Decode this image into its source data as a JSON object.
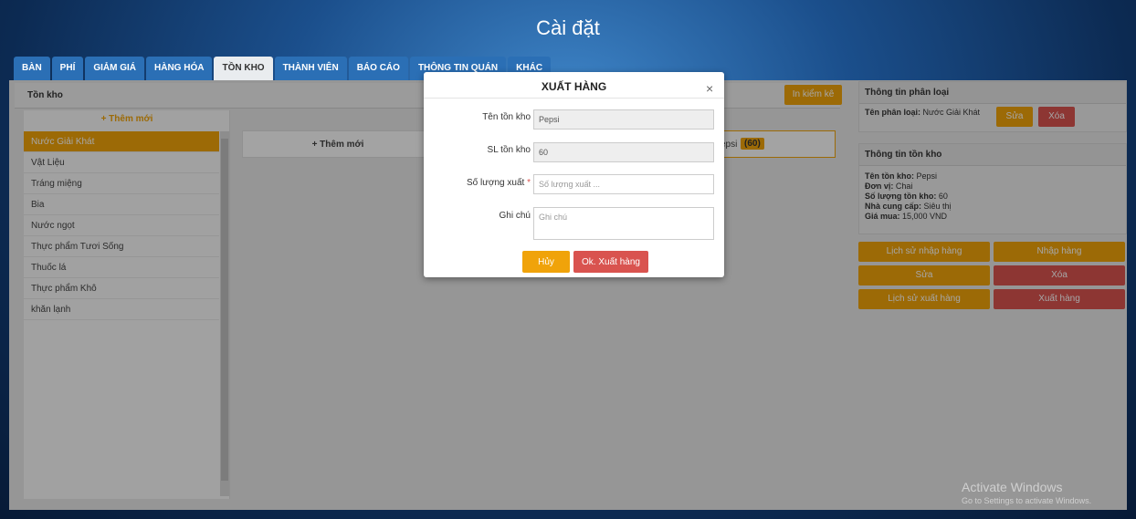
{
  "window": {
    "title": "Cài đặt"
  },
  "tabs": [
    {
      "label": "BÀN"
    },
    {
      "label": "PHÍ"
    },
    {
      "label": "GIẢM GIÁ"
    },
    {
      "label": "HÀNG HÓA"
    },
    {
      "label": "TỒN KHO",
      "active": true
    },
    {
      "label": "THÀNH VIÊN"
    },
    {
      "label": "BÁO CÁO"
    },
    {
      "label": "THÔNG TIN QUÁN"
    },
    {
      "label": "KHÁC"
    }
  ],
  "inventory": {
    "header": "Tồn kho",
    "print_button": "In kiểm kê",
    "add_category": "+ Thêm mới",
    "add_item": "+ Thêm mới",
    "categories": [
      "Nước Giải Khát",
      "Vật Liệu",
      "Tráng miệng",
      "Bia",
      "Nước ngọt",
      "Thực phẩm Tươi Sống",
      "Thuốc lá",
      "Thực phẩm Khô",
      "khăn lạnh"
    ],
    "items": [
      {
        "name": "epsi",
        "qty": "(60)"
      }
    ]
  },
  "category_info": {
    "title": "Thông tin phân loại",
    "label": "Tên phân loại:",
    "value": "Nước Giải Khát",
    "edit": "Sửa",
    "delete": "Xóa"
  },
  "stock_info": {
    "title": "Thông tin tồn kho",
    "lines": [
      {
        "label": "Tên tồn kho:",
        "value": "Pepsi"
      },
      {
        "label": "Đơn vị:",
        "value": "Chai"
      },
      {
        "label": "Số lượng tồn kho:",
        "value": "60"
      },
      {
        "label": "Nhà cung cấp:",
        "value": "Siêu thị"
      },
      {
        "label": "Giá mua:",
        "value": "15,000 VND"
      }
    ],
    "buttons": {
      "import_history": "Lịch sử nhập hàng",
      "import": "Nhập hàng",
      "edit": "Sửa",
      "delete": "Xóa",
      "export_history": "Lịch sử xuất hàng",
      "export": "Xuất hàng"
    }
  },
  "modal": {
    "title": "XUẤT HÀNG",
    "close": "×",
    "fields": {
      "name_label": "Tên tồn kho",
      "name_value": "Pepsi",
      "stock_label": "SL tồn kho",
      "stock_value": "60",
      "qty_label": "Số lượng xuất",
      "qty_required": "*",
      "qty_placeholder": "Số lượng xuất ...",
      "note_label": "Ghi chú",
      "note_placeholder": "Ghi chú"
    },
    "cancel": "Hủy",
    "confirm": "Ok. Xuất hàng"
  },
  "watermark": {
    "line1": "Activate Windows",
    "line2": "Go to Settings to activate Windows."
  },
  "colors": {
    "accent": "#f0a30a",
    "danger": "#d9534f",
    "tab": "#2b6fb5"
  }
}
